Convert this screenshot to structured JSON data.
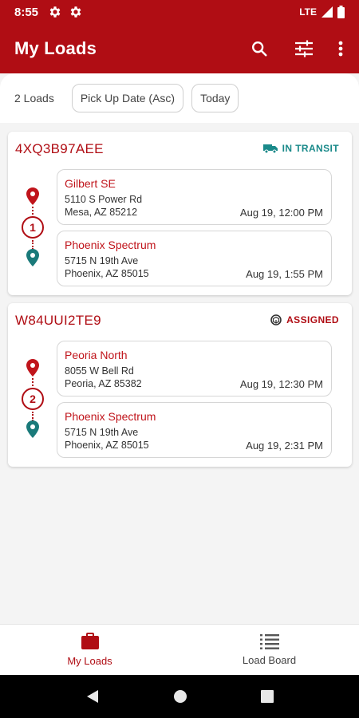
{
  "status_bar": {
    "time": "8:55",
    "network": "LTE"
  },
  "app_bar": {
    "title": "My Loads",
    "icons": [
      "search-icon",
      "filter-sliders-icon",
      "more-vert-icon"
    ]
  },
  "filters": {
    "count": "2 Loads",
    "sort_chip": "Pick Up Date (Asc)",
    "date_chip": "Today"
  },
  "loads": [
    {
      "id": "4XQ3B97AEE",
      "status": "IN TRANSIT",
      "status_color": "#1a8a8a",
      "status_icon": "truck-icon",
      "stop_count": "1",
      "stops": [
        {
          "name": "Gilbert SE",
          "line1": "5110 S Power Rd",
          "line2": "Mesa, AZ 85212",
          "time": "Aug 19, 12:00 PM"
        },
        {
          "name": "Phoenix Spectrum",
          "line1": "5715 N 19th Ave",
          "line2": "Phoenix, AZ 85015",
          "time": "Aug 19, 1:55 PM"
        }
      ]
    },
    {
      "id": "W84UUI2TE9",
      "status": "ASSIGNED",
      "status_color": "#b00d14",
      "status_icon": "package-icon",
      "stop_count": "2",
      "stops": [
        {
          "name": "Peoria North",
          "line1": "8055 W Bell Rd",
          "line2": "Peoria, AZ 85382",
          "time": "Aug 19, 12:30 PM"
        },
        {
          "name": "Phoenix Spectrum",
          "line1": "5715 N 19th Ave",
          "line2": "Phoenix, AZ 85015",
          "time": "Aug 19, 2:31 PM"
        }
      ]
    }
  ],
  "bottom_nav": {
    "my_loads": "My Loads",
    "load_board": "Load Board",
    "active_color": "#b00d14"
  },
  "colors": {
    "brand": "#b00d14",
    "pickup_pin": "#c0141b",
    "dropoff_pin": "#1a7a7a"
  }
}
